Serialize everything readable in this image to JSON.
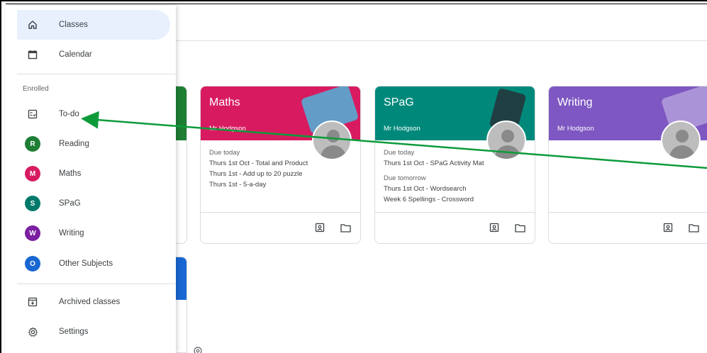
{
  "drawer": {
    "top_items": [
      {
        "label": "Classes",
        "icon": "home-icon",
        "active": true
      },
      {
        "label": "Calendar",
        "icon": "calendar-icon",
        "active": false
      }
    ],
    "section_label": "Enrolled",
    "enrolled_items": [
      {
        "label": "To-do",
        "icon": "todo-icon"
      },
      {
        "label": "Reading",
        "letter": "R",
        "color": "#1e7e34"
      },
      {
        "label": "Maths",
        "letter": "M",
        "color": "#d81b60"
      },
      {
        "label": "SPaG",
        "letter": "S",
        "color": "#00796b"
      },
      {
        "label": "Writing",
        "letter": "W",
        "color": "#7b1fa2"
      },
      {
        "label": "Other Subjects",
        "letter": "O",
        "color": "#1967d2"
      }
    ],
    "bottom_items": [
      {
        "label": "Archived classes",
        "icon": "archive-icon"
      },
      {
        "label": "Settings",
        "icon": "gear-icon"
      }
    ]
  },
  "cards": [
    {
      "title": "Maths",
      "teacher": "Mr Hodgson",
      "color": "#d81b60",
      "groups": [
        {
          "label": "Due today",
          "items": [
            "Thurs 1st Oct - Total and Product",
            "Thurs 1st - Add up to 20 puzzle",
            "Thurs 1st - 5-a-day"
          ]
        }
      ]
    },
    {
      "title": "SPaG",
      "teacher": "Mr Hodgson",
      "color": "#00897b",
      "groups": [
        {
          "label": "Due today",
          "items": [
            "Thurs 1st Oct - SPaG Activity Mat"
          ]
        },
        {
          "label": "Due tomorrow",
          "items": [
            "Thurs 1st Oct - Wordsearch",
            "Week 6 Spellings - Crossword"
          ]
        }
      ]
    },
    {
      "title": "Writing",
      "teacher": "Mr Hodgson",
      "color": "#7e57c2",
      "groups": []
    }
  ],
  "annotation": {
    "color": "#0d9b3a"
  }
}
